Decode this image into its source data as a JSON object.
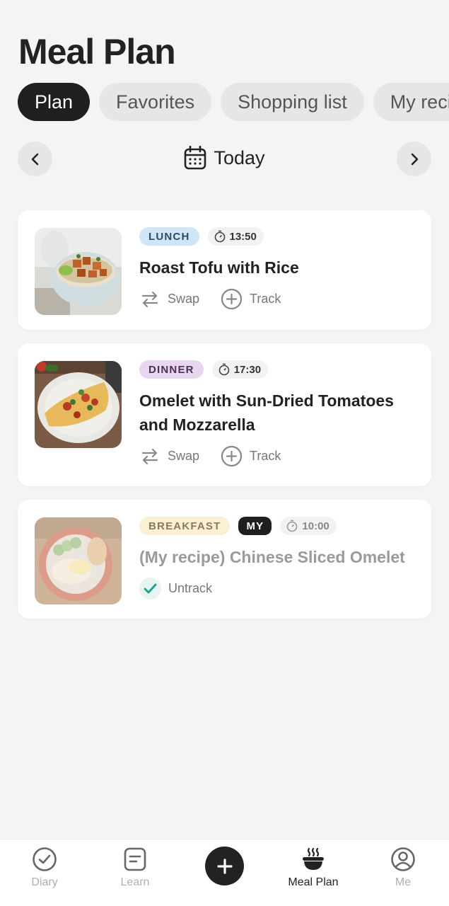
{
  "header": {
    "title": "Meal Plan"
  },
  "tabs": [
    {
      "label": "Plan",
      "active": true
    },
    {
      "label": "Favorites"
    },
    {
      "label": "Shopping list"
    },
    {
      "label": "My recipes"
    }
  ],
  "date_nav": {
    "label": "Today",
    "icon": "calendar-icon"
  },
  "meals": [
    {
      "badge": "LUNCH",
      "time": "13:50",
      "title": "Roast Tofu with Rice",
      "actions": {
        "swap": "Swap",
        "track": "Track"
      }
    },
    {
      "badge": "DINNER",
      "time": "17:30",
      "title": "Omelet with Sun-Dried Tomatoes and Mozzarella",
      "actions": {
        "swap": "Swap",
        "track": "Track"
      }
    },
    {
      "badge": "BREAKFAST",
      "my_badge": "MY",
      "time": "10:00",
      "title": "(My recipe) Chinese Sliced Omelet",
      "actions": {
        "untrack": "Untrack"
      }
    }
  ],
  "bottom_nav": {
    "items": [
      {
        "label": "Diary",
        "icon": "check-circle-icon"
      },
      {
        "label": "Learn",
        "icon": "document-icon"
      },
      {
        "label": "Meal Plan",
        "icon": "bowl-icon",
        "active": true
      },
      {
        "label": "Me",
        "icon": "profile-icon"
      }
    ],
    "add_icon": "plus-icon"
  },
  "colors": {
    "lunch": "#cfe6f8",
    "dinner": "#e8d6ef",
    "breakfast": "#fbf0d4",
    "active": "#1f1f1f",
    "check": "#1aa38c"
  }
}
